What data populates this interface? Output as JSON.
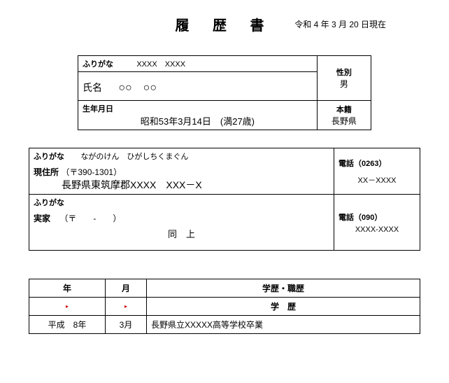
{
  "header": {
    "title": "履 歴 書",
    "date": "令和 4 年 3 月 20 日現在"
  },
  "personal": {
    "furigana_label": "ふりがな",
    "furigana": "XXXX　XXXX",
    "name_label": "氏名",
    "name": "○○　○○",
    "gender_label": "性別",
    "gender": "男",
    "birth_label": "生年月日",
    "birth": "昭和53年3月14日　(満27歳)",
    "honseki_label": "本籍",
    "honseki": "長野県"
  },
  "address": {
    "furigana_label": "ふりがな",
    "current_furigana": "ながのけん　ひがしちくまぐん",
    "current_label": "現住所",
    "current_postal": "（〒390-1301）",
    "current_value": "長野県東筑摩郡XXXX　XXX－X",
    "phone1_label": "電話（0263）",
    "phone1_value": "XX－XXXX",
    "home_furigana_label": "ふりがな",
    "home_label": "実家",
    "home_postal": "（〒　　-　　）",
    "home_value": "同　上",
    "phone2_label": "電話（090）",
    "phone2_value": "XXXX-XXXX"
  },
  "history": {
    "col_year": "年",
    "col_month": "月",
    "col_history": "学歴・職歴",
    "section": "学　歴",
    "rows": [
      {
        "year": "平成　8年",
        "month": "3月",
        "entry": "長野県立XXXXX高等学校卒業"
      }
    ]
  }
}
